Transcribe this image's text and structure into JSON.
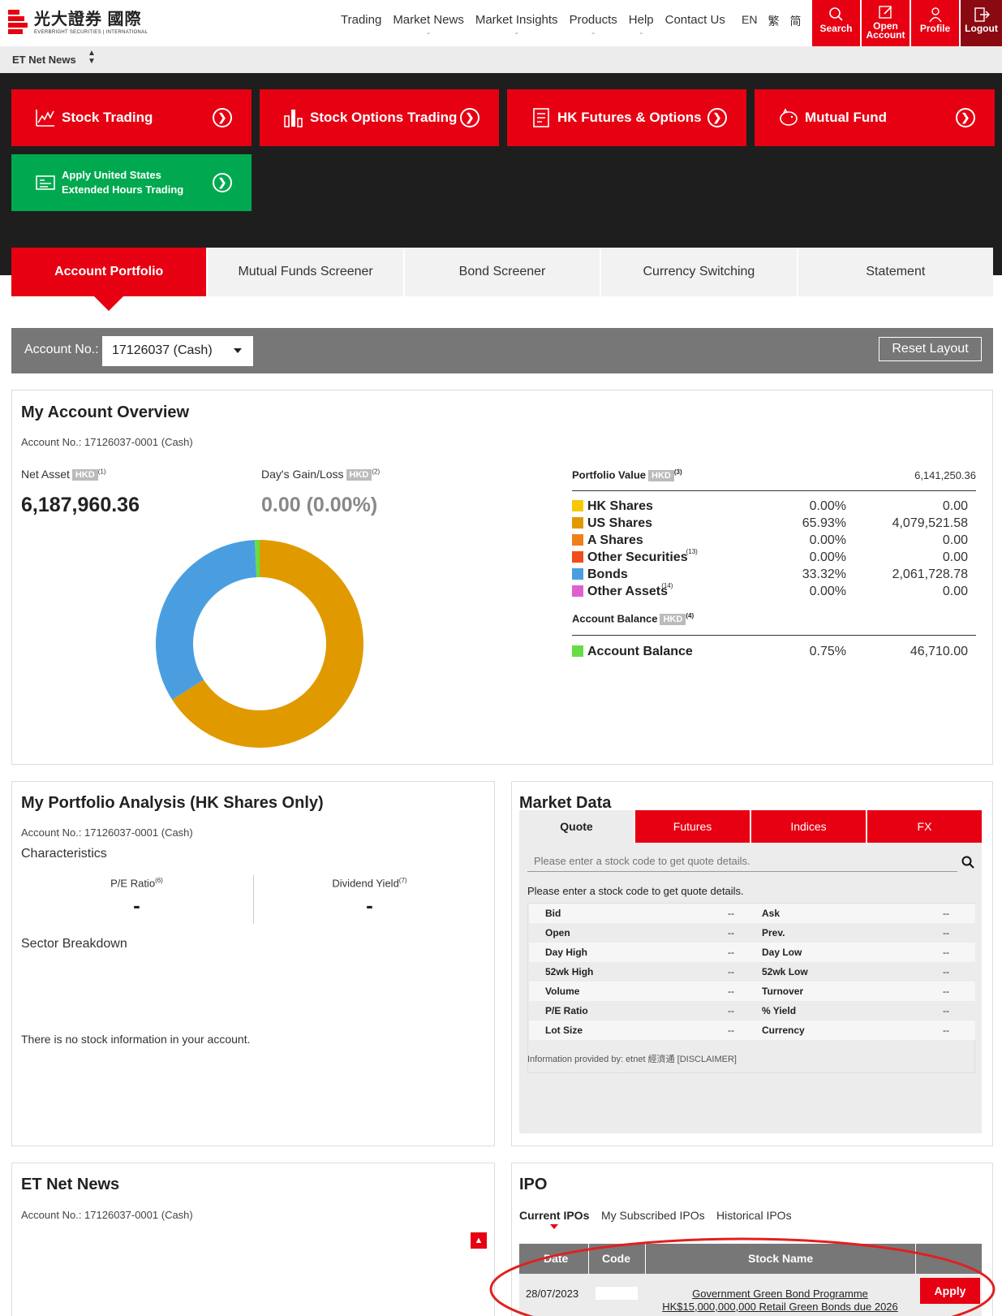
{
  "brand": {
    "cn": "光大證券 國際",
    "en_left": "EVERBRIGHT SECURITIES",
    "en_right": "INTERNATIONAL"
  },
  "nav": [
    "Trading",
    "Market News",
    "Market Insights",
    "Products",
    "Help",
    "Contact Us"
  ],
  "lang": [
    "EN",
    "繁",
    "简"
  ],
  "top_buttons": {
    "search": "Search",
    "open_account_1": "Open",
    "open_account_2": "Account",
    "profile": "Profile",
    "logout": "Logout"
  },
  "subbar": {
    "title": "ET Net News"
  },
  "quick": {
    "stock_trading": "Stock Trading",
    "stock_options": "Stock Options Trading",
    "hk_futures": "HK Futures & Options",
    "mutual_fund": "Mutual Fund",
    "us_ext_1": "Apply United States",
    "us_ext_2": "Extended Hours Trading"
  },
  "tabs": [
    "Account Portfolio",
    "Mutual Funds Screener",
    "Bond Screener",
    "Currency Switching",
    "Statement"
  ],
  "account_bar": {
    "label": "Account No.:",
    "selected": "17126037 (Cash)",
    "reset": "Reset Layout"
  },
  "overview": {
    "title": "My Account Overview",
    "account": "Account No.: 17126037-0001 (Cash)",
    "net_asset_label": "Net Asset",
    "net_asset_value": "6,187,960.36",
    "gain_label": "Day's Gain/Loss",
    "gain_value": "0.00 (0.00%)",
    "currency": "HKD",
    "sup1": "(1)",
    "sup2": "(2)",
    "sup3": "(3)",
    "sup4": "(4)",
    "portfolio_label": "Portfolio Value",
    "portfolio_value": "6,141,250.36",
    "rows": [
      {
        "name": "HK Shares",
        "pct": "0.00%",
        "val": "0.00",
        "color": "#f5c800",
        "sup": ""
      },
      {
        "name": "US Shares",
        "pct": "65.93%",
        "val": "4,079,521.58",
        "color": "#e09a00",
        "sup": ""
      },
      {
        "name": "A Shares",
        "pct": "0.00%",
        "val": "0.00",
        "color": "#f07f1a",
        "sup": ""
      },
      {
        "name": "Other Securities",
        "pct": "0.00%",
        "val": "0.00",
        "color": "#f04e1a",
        "sup": "(13)"
      },
      {
        "name": "Bonds",
        "pct": "33.32%",
        "val": "2,061,728.78",
        "color": "#4a9ee0",
        "sup": ""
      },
      {
        "name": "Other Assets",
        "pct": "0.00%",
        "val": "0.00",
        "color": "#e060d0",
        "sup": "(14)"
      }
    ],
    "balance_label": "Account Balance",
    "balance_row": {
      "name": "Account Balance",
      "pct": "0.75%",
      "val": "46,710.00",
      "color": "#66dd44"
    }
  },
  "chart_data": {
    "type": "pie",
    "categories": [
      "HK Shares",
      "US Shares",
      "A Shares",
      "Other Securities",
      "Bonds",
      "Other Assets",
      "Account Balance"
    ],
    "values": [
      0.0,
      65.93,
      0.0,
      0.0,
      33.32,
      0.0,
      0.75
    ],
    "colors": [
      "#f5c800",
      "#e09a00",
      "#f07f1a",
      "#f04e1a",
      "#4a9ee0",
      "#e060d0",
      "#66dd44"
    ]
  },
  "analysis": {
    "title": "My Portfolio Analysis (HK Shares Only)",
    "account": "Account No.: 17126037-0001 (Cash)",
    "characteristics": "Characteristics",
    "pe_label": "P/E Ratio",
    "pe_sup": "(6)",
    "pe_value": "-",
    "dy_label": "Dividend Yield",
    "dy_sup": "(7)",
    "dy_value": "-",
    "sector": "Sector Breakdown",
    "empty": "There is no stock information in your account."
  },
  "market": {
    "title": "Market Data",
    "tabs": [
      "Quote",
      "Futures",
      "Indices",
      "FX"
    ],
    "placeholder": "Please enter a stock code to get quote details.",
    "hint": "Please enter a stock code to get quote details.",
    "rows": [
      [
        "Bid",
        "--",
        "Ask",
        "--"
      ],
      [
        "Open",
        "--",
        "Prev.",
        "--"
      ],
      [
        "Day High",
        "--",
        "Day Low",
        "--"
      ],
      [
        "52wk High",
        "--",
        "52wk Low",
        "--"
      ],
      [
        "Volume",
        "--",
        "Turnover",
        "--"
      ],
      [
        "P/E Ratio",
        "--",
        "% Yield",
        "--"
      ],
      [
        "Lot Size",
        "--",
        "Currency",
        "--"
      ]
    ],
    "source": "Information provided by: etnet 經濟通 [DISCLAIMER]"
  },
  "news": {
    "title": "ET Net News",
    "account": "Account No.: 17126037-0001 (Cash)"
  },
  "ipo": {
    "title": "IPO",
    "tabs": [
      "Current IPOs",
      "My Subscribed IPOs",
      "Historical IPOs"
    ],
    "headers": [
      "Date",
      "Code",
      "Stock Name"
    ],
    "row": {
      "date": "28/07/2023",
      "name_1": "Government Green Bond Programme",
      "name_2": "HK$15,000,000,000 Retail Green Bonds due 2026",
      "apply": "Apply"
    }
  }
}
